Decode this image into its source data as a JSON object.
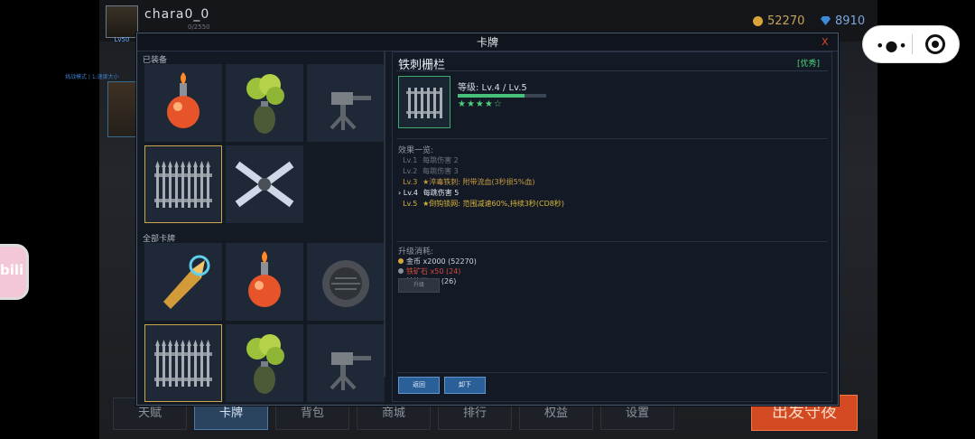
{
  "topbar": {
    "username": "chara0_0",
    "avatar_level": "Lv50",
    "exp": "0/2550",
    "gold": "52270",
    "gems": "8910"
  },
  "side_note": "挑战模式 | 1:速度大小",
  "modal": {
    "title": "卡牌",
    "close": "X",
    "equipped_label": "已装备",
    "all_label": "全部卡牌"
  },
  "equipped_cards": [
    {
      "icon": "fire-bottle-icon",
      "selected": false
    },
    {
      "icon": "poison-grenade-icon",
      "selected": false
    },
    {
      "icon": "turret-icon",
      "selected": false
    },
    {
      "icon": "iron-fence-icon",
      "selected": true
    },
    {
      "icon": "blade-drone-icon",
      "selected": false
    }
  ],
  "all_cards": [
    {
      "icon": "ice-bullet-icon",
      "selected": false
    },
    {
      "icon": "fire-bottle-icon",
      "selected": false
    },
    {
      "icon": "landmine-icon",
      "selected": false
    },
    {
      "icon": "iron-fence-icon",
      "selected": true
    },
    {
      "icon": "poison-grenade-icon",
      "selected": false
    },
    {
      "icon": "turret-icon",
      "selected": false
    }
  ],
  "detail": {
    "name": "铁刺栅栏",
    "rank": "[优秀]",
    "level": "等级: Lv.4 / Lv.5",
    "level_progress": 0.75,
    "stars": "★★★★☆",
    "effects_title": "效果一览:",
    "effects": [
      {
        "lv": "Lv.1",
        "text": "每跳伤害 2",
        "color": "#6a7380",
        "current": false
      },
      {
        "lv": "Lv.2",
        "text": "每跳伤害 3",
        "color": "#6a7380",
        "current": false
      },
      {
        "lv": "Lv.3",
        "text": "★淬毒铁刺: 附带流血(3秒损5%血)",
        "color": "#c99a3f",
        "current": false
      },
      {
        "lv": "Lv.4",
        "text": "每跳伤害 5",
        "color": "#e6ebf2",
        "current": true
      },
      {
        "lv": "Lv.5",
        "text": "★倒钩锁网: 范围减速60%,持续3秒(CD8秒)",
        "color": "#d9b43a",
        "current": false
      }
    ],
    "cost_title": "升级消耗:",
    "costs": [
      {
        "text": "金币 x2000 (52270)",
        "color": "#cfd6e0",
        "dot": "#d9a43a"
      },
      {
        "text": "铁矿石 x50 (24)",
        "color": "#d44a3a",
        "dot": "#8a8f98"
      },
      {
        "text": "精炼石 x4 (26)",
        "color": "#cfd6e0",
        "dot": "#3f8de0"
      }
    ],
    "upgrade": "升级",
    "back": "返回",
    "unequip": "卸下"
  },
  "bottom_nav": [
    "天赋",
    "卡牌",
    "背包",
    "商城",
    "排行",
    "权益",
    "设置"
  ],
  "bottom_nav_active": 1,
  "depart": "出发守夜",
  "bili": "bili",
  "colors": {
    "accent": "#c9a74a",
    "rank_green": "#4fd07a",
    "depart": "#d34a22"
  }
}
